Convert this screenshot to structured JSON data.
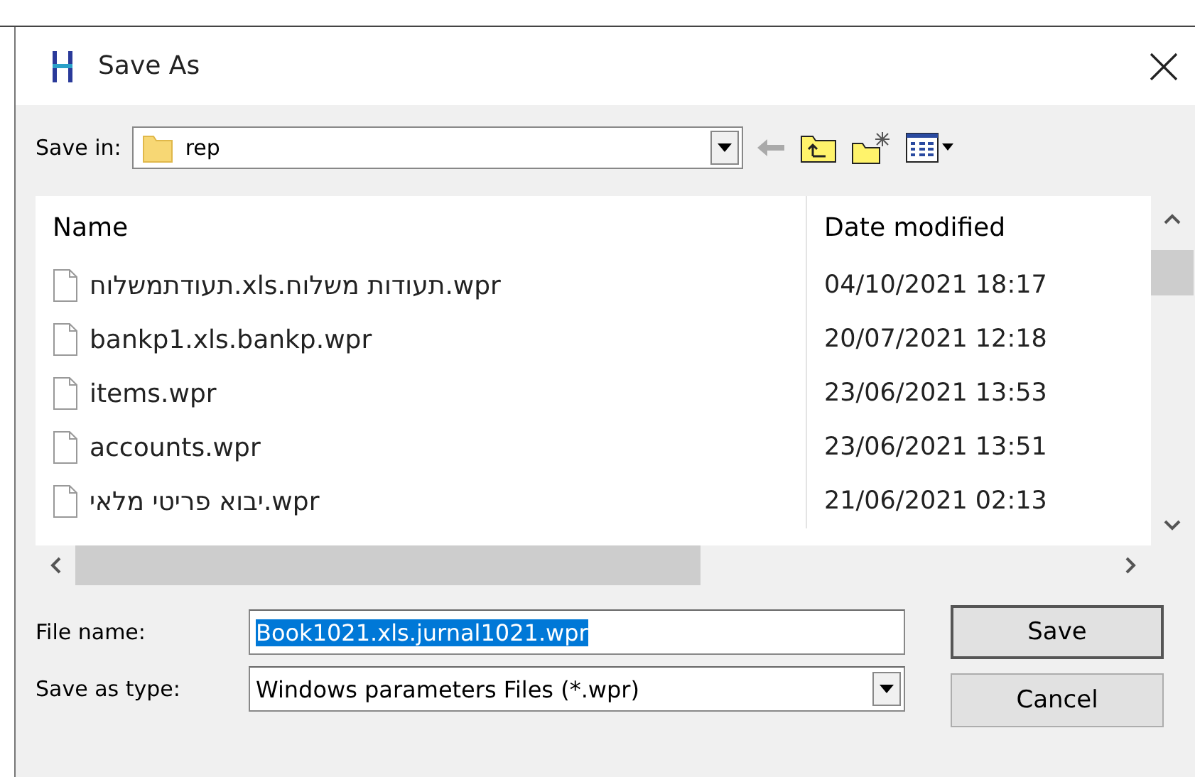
{
  "window": {
    "title": "Save As"
  },
  "save_in": {
    "label": "Save in:",
    "value": "rep"
  },
  "table": {
    "columns": [
      "Name",
      "Date modified"
    ],
    "rows": [
      {
        "name": "תעודתמשלוח.xls.תעודות משלוח.wpr",
        "date": "04/10/2021 18:17"
      },
      {
        "name": "bankp1.xls.bankp.wpr",
        "date": "20/07/2021 12:18"
      },
      {
        "name": "items.wpr",
        "date": "23/06/2021 13:53"
      },
      {
        "name": "accounts.wpr",
        "date": "23/06/2021 13:51"
      },
      {
        "name": "יבוא פריטי מלאי.wpr",
        "date": "21/06/2021 02:13"
      }
    ]
  },
  "file_name": {
    "label": "File name:",
    "value": "Book1021.xls.jurnal1021.wpr"
  },
  "save_as_type": {
    "label": "Save as type:",
    "value": "Windows parameters Files (*.wpr)"
  },
  "buttons": [
    "Save",
    "Cancel"
  ]
}
